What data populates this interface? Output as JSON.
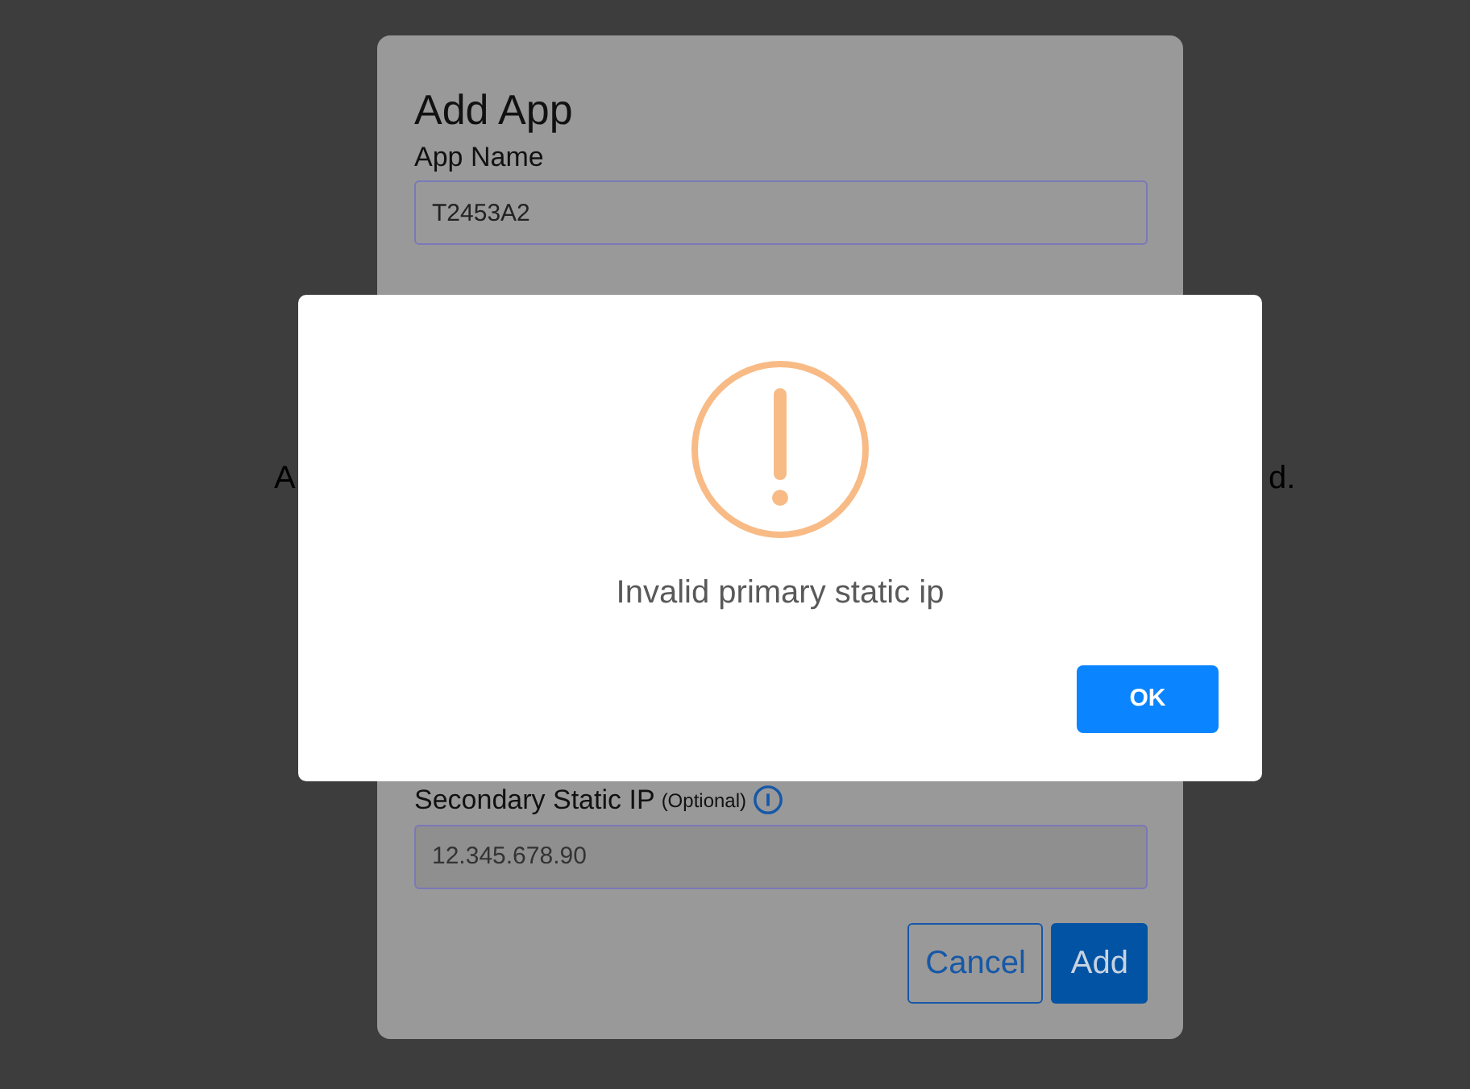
{
  "background_text": {
    "left": "A",
    "right": "d."
  },
  "dialog": {
    "title": "Add App",
    "app_name": {
      "label": "App Name",
      "value": "T2453A2"
    },
    "secondary_ip": {
      "label": "Secondary Static IP",
      "hint": "(Optional)",
      "value": "12.345.678.90"
    },
    "buttons": [
      {
        "label": "Cancel",
        "kind": "outline"
      },
      {
        "label": "Add",
        "kind": "primary"
      }
    ]
  },
  "alert": {
    "message": "Invalid primary static ip",
    "button": "OK"
  }
}
